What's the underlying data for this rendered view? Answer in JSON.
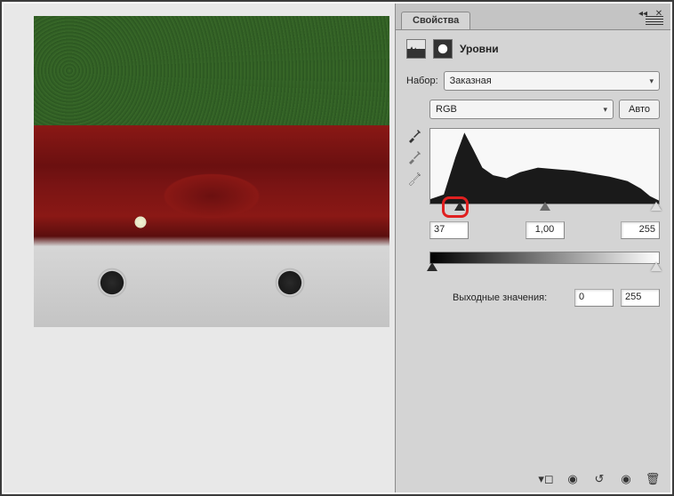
{
  "panel": {
    "tab_title": "Свойства",
    "adjustment_title": "Уровни",
    "preset_label": "Набор:",
    "preset_value": "Заказная",
    "channel_value": "RGB",
    "auto_label": "Авто",
    "input_black": "37",
    "input_gamma": "1,00",
    "input_white": "255",
    "output_label": "Выходные значения:",
    "output_black": "0",
    "output_white": "255"
  },
  "chart_data": {
    "type": "area",
    "title": "Histogram",
    "xlabel": "",
    "ylabel": "",
    "xlim": [
      0,
      255
    ],
    "x": [
      0,
      15,
      28,
      38,
      48,
      58,
      70,
      85,
      100,
      120,
      140,
      160,
      180,
      200,
      220,
      235,
      245,
      255
    ],
    "values": [
      6,
      12,
      62,
      95,
      72,
      48,
      38,
      34,
      42,
      48,
      46,
      44,
      40,
      36,
      30,
      20,
      10,
      4
    ],
    "sliders": {
      "black": 37,
      "mid": 128,
      "white": 255
    }
  }
}
